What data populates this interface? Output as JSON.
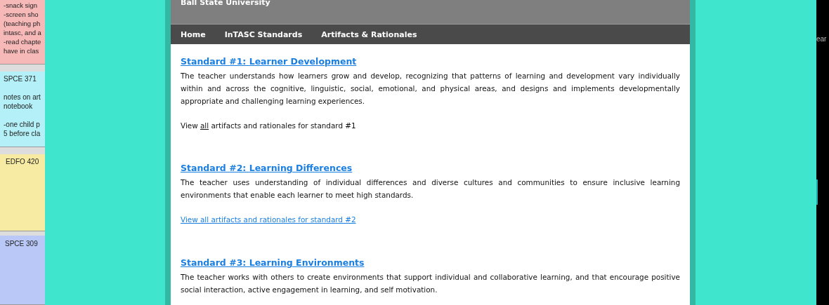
{
  "notes": [
    {
      "color": "#f7b8b8",
      "paragraphs": [
        [
          "-snack sign",
          "-screen sho",
          "(teaching ph",
          "intasc, and a",
          "-read chapte",
          "have in clas"
        ]
      ]
    },
    {
      "color": "#b3f0f7",
      "paragraphs": [
        [
          "SPCE 371"
        ],
        [
          "notes on art",
          "notebook"
        ],
        [
          "-one child p",
          "5 before cla"
        ]
      ]
    },
    {
      "color": "#f7eaa2",
      "paragraphs": [
        [
          "EDFO 420"
        ]
      ]
    },
    {
      "color": "#b9c8f7",
      "paragraphs": [
        [
          "SPCE 309"
        ]
      ]
    }
  ],
  "site": {
    "title": "Ball State University",
    "nav": [
      {
        "label": "Home"
      },
      {
        "label": "InTASC Standards"
      },
      {
        "label": "Artifacts & Rationales"
      }
    ],
    "standards": [
      {
        "title": "Standard #1: Learner Development",
        "text": "The teacher understands how learners grow and develop, recognizing that patterns of learning and development vary individually within and across the cognitive, linguistic, social, emotional, and physical areas, and designs and implements developmentally appropriate and challenging learning experiences.",
        "kind": "inline",
        "link_before": "View ",
        "link": "all",
        "link_after": " artifacts and rationales for standard #1"
      },
      {
        "title": "Standard #2: Learning Differences",
        "text": "The teacher uses understanding of individual differences and diverse cultures and communities to ensure inclusive learning environments that enable each learner to meet high standards.",
        "kind": "full",
        "link": "View all artifacts and rationales for standard #2"
      },
      {
        "title": "Standard #3: Learning Environments",
        "text": "The teacher works with others to create environments that support individual and collaborative learning, and that encourage positive social interaction, active engagement in learning, and self motivation."
      }
    ]
  },
  "right_window": {
    "text": "ear"
  }
}
